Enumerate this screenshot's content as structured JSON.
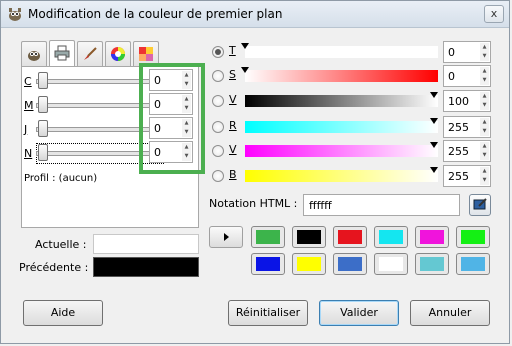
{
  "window": {
    "title": "Modification de la couleur de premier plan",
    "close_label": "x"
  },
  "tabs": [
    {
      "icon": "gimp-wilber-icon",
      "active": false
    },
    {
      "icon": "printer-icon",
      "active": true
    },
    {
      "icon": "paintbrush-icon",
      "active": false
    },
    {
      "icon": "color-wheel-icon",
      "active": false
    },
    {
      "icon": "palette-icon",
      "active": false
    }
  ],
  "cmyk": {
    "sliders": [
      {
        "label": "C",
        "value": "0"
      },
      {
        "label": "M",
        "value": "0"
      },
      {
        "label": "J",
        "value": "0"
      },
      {
        "label": "N",
        "value": "0"
      }
    ],
    "profil": "Profil : (aucun)"
  },
  "channels": [
    {
      "label": "T",
      "value": "0",
      "checked": true
    },
    {
      "label": "S",
      "value": "0",
      "checked": false
    },
    {
      "label": "V",
      "value": "100",
      "checked": false
    },
    {
      "label": "R",
      "value": "255",
      "checked": false
    },
    {
      "label": "V",
      "value": "255",
      "checked": false
    },
    {
      "label": "B",
      "value": "255",
      "checked": false
    }
  ],
  "notation": {
    "label": "Notation HTML :",
    "value": "ffffff"
  },
  "history": {
    "colors": [
      "#3cb44b",
      "#000000",
      "#e6141e",
      "#14e6f0",
      "#f014dc",
      "#14f014",
      "#0a14e6",
      "#ffff00",
      "#3c6ec8",
      "#ffffff",
      "#64c8d2",
      "#50b4e6"
    ]
  },
  "preview": {
    "actuelle_label": "Actuelle :",
    "precedente_label": "Précédente :",
    "actuelle_color": "#ffffff",
    "precedente_color": "#000000"
  },
  "buttons": {
    "aide": "Aide",
    "reinitialiser": "Réinitialiser",
    "valider": "Valider",
    "annuler": "Annuler"
  },
  "accent": {
    "highlight": "#4caf50"
  }
}
